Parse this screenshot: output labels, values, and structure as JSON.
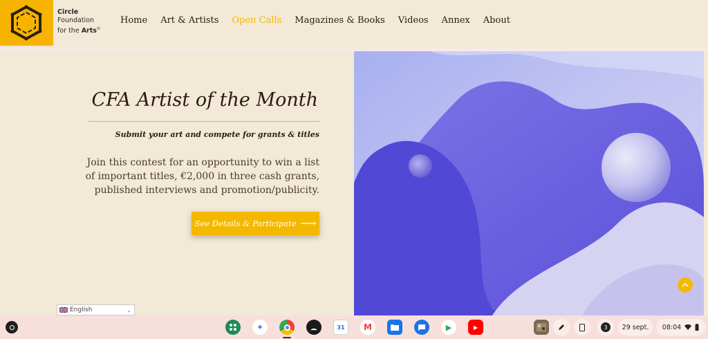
{
  "brand": {
    "line1": "Circle",
    "line2": "Foundation",
    "line3_prefix": "for the ",
    "line3_bold": "Arts",
    "line3_mark": "®",
    "accent": "#f6b400"
  },
  "nav": {
    "items": [
      {
        "label": "Home",
        "active": false
      },
      {
        "label": "Art & Artists",
        "active": false
      },
      {
        "label": "Open Calls",
        "active": true
      },
      {
        "label": "Magazines & Books",
        "active": false
      },
      {
        "label": "Videos",
        "active": false
      },
      {
        "label": "Annex",
        "active": false
      },
      {
        "label": "About",
        "active": false
      }
    ]
  },
  "hero": {
    "title": "CFA Artist of the Month",
    "subtitle": "Submit your art and compete for grants & titles",
    "body": "Join this contest for an opportunity to win a list of important titles, €2,000 in three cash grants, published interviews and promotion/publicity.",
    "cta_label": "See Details & Participate",
    "cta_arrow": "⟶"
  },
  "language": {
    "selected": "English",
    "flag": "uk-flag-icon"
  },
  "scroll_top": {
    "icon": "chevron-up-icon",
    "glyph": "⌃"
  },
  "taskbar": {
    "apps": [
      {
        "name": "google-apps-icon",
        "label": ""
      },
      {
        "name": "gemini-icon",
        "label": "✦"
      },
      {
        "name": "chrome-icon",
        "label": ""
      },
      {
        "name": "podcasts-icon",
        "label": ""
      },
      {
        "name": "calendar-icon",
        "label": "31"
      },
      {
        "name": "gmail-icon",
        "label": "M"
      },
      {
        "name": "files-icon",
        "label": ""
      },
      {
        "name": "messages-icon",
        "label": ""
      },
      {
        "name": "play-store-icon",
        "label": "▶"
      },
      {
        "name": "youtube-icon",
        "label": "▶"
      }
    ],
    "notification_count": "3",
    "date": "29 sept.",
    "time": "08:04"
  }
}
